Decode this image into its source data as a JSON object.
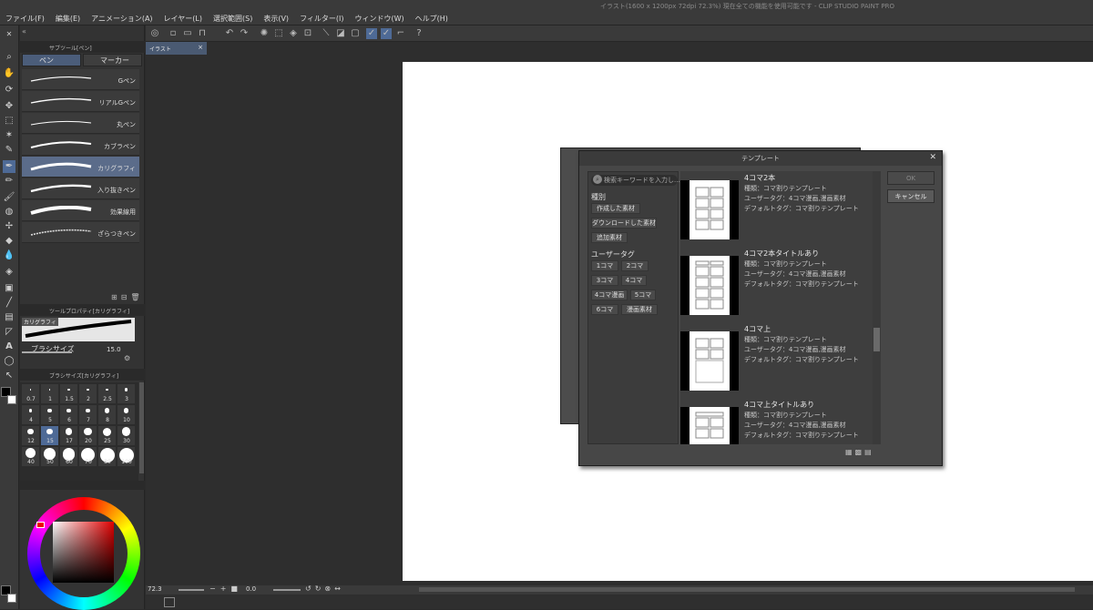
{
  "app": {
    "title_bar": "イラスト(1600 x 1200px 72dpi 72.3%)  現在全ての機能を使用可能です - CLIP STUDIO PAINT PRO"
  },
  "menu": [
    "ファイル(F)",
    "編集(E)",
    "アニメーション(A)",
    "レイヤー(L)",
    "選択範囲(S)",
    "表示(V)",
    "フィルター(I)",
    "ウィンドウ(W)",
    "ヘルプ(H)"
  ],
  "subtool": {
    "header": "サブツール[ペン]",
    "tabs": [
      "ペン",
      "マーカー"
    ],
    "brushes": [
      "Gペン",
      "リアルGペン",
      "丸ペン",
      "カブラペン",
      "カリグラフィ",
      "入り抜きペン",
      "効果線用",
      "ざらつきペン"
    ],
    "active_brush": "カリグラフィ"
  },
  "tool_property": {
    "header": "ツールプロパティ[カリグラフィ]",
    "preview_label": "カリグラフィ",
    "brush_size_label": "ブラシサイズ",
    "brush_size_value": "15.0"
  },
  "brush_size_panel": {
    "header": "ブラシサイズ[カリグラフィ]",
    "sizes": [
      "0.7",
      "1",
      "1.5",
      "2",
      "2.5",
      "3",
      "4",
      "5",
      "6",
      "7",
      "8",
      "10",
      "12",
      "15",
      "17",
      "20",
      "25",
      "30",
      "40",
      "50",
      "60",
      "70",
      "80",
      "100"
    ],
    "selected": "15"
  },
  "document": {
    "tab": "イラスト",
    "zoom": "72.3",
    "rotation": "0.0"
  },
  "dialog": {
    "title": "テンプレート",
    "search_placeholder": "検索キーワードを入力し...",
    "category_label": "種別",
    "category_buttons": [
      "作成した素材",
      "ダウンロードした素材",
      "追加素材"
    ],
    "user_tag_label": "ユーザータグ",
    "user_tags": [
      "1コマ",
      "2コマ",
      "3コマ",
      "4コマ",
      "4コマ漫画",
      "5コマ",
      "6コマ",
      "漫画素材"
    ],
    "items": [
      {
        "title": "4コマ2本",
        "kind": "種類：コマ割りテンプレート",
        "user_tag": "ユーザータグ：4コマ漫画,漫画素材",
        "default_tag": "デフォルトタグ：コマ割りテンプレート"
      },
      {
        "title": "4コマ2本タイトルあり",
        "kind": "種類：コマ割りテンプレート",
        "user_tag": "ユーザータグ：4コマ漫画,漫画素材",
        "default_tag": "デフォルトタグ：コマ割りテンプレート"
      },
      {
        "title": "4コマ上",
        "kind": "種類：コマ割りテンプレート",
        "user_tag": "ユーザータグ：4コマ漫画,漫画素材",
        "default_tag": "デフォルトタグ：コマ割りテンプレート"
      },
      {
        "title": "4コマ上タイトルあり",
        "kind": "種類：コマ割りテンプレート",
        "user_tag": "ユーザータグ：4コマ漫画,漫画素材",
        "default_tag": "デフォルトタグ：コマ割りテンプレート"
      }
    ],
    "ok_label": "OK",
    "cancel_label": "キャンセル"
  },
  "colors": {
    "accent": "#4e6a96",
    "panel": "#333333",
    "canvas_bg": "#2e2e2e"
  }
}
